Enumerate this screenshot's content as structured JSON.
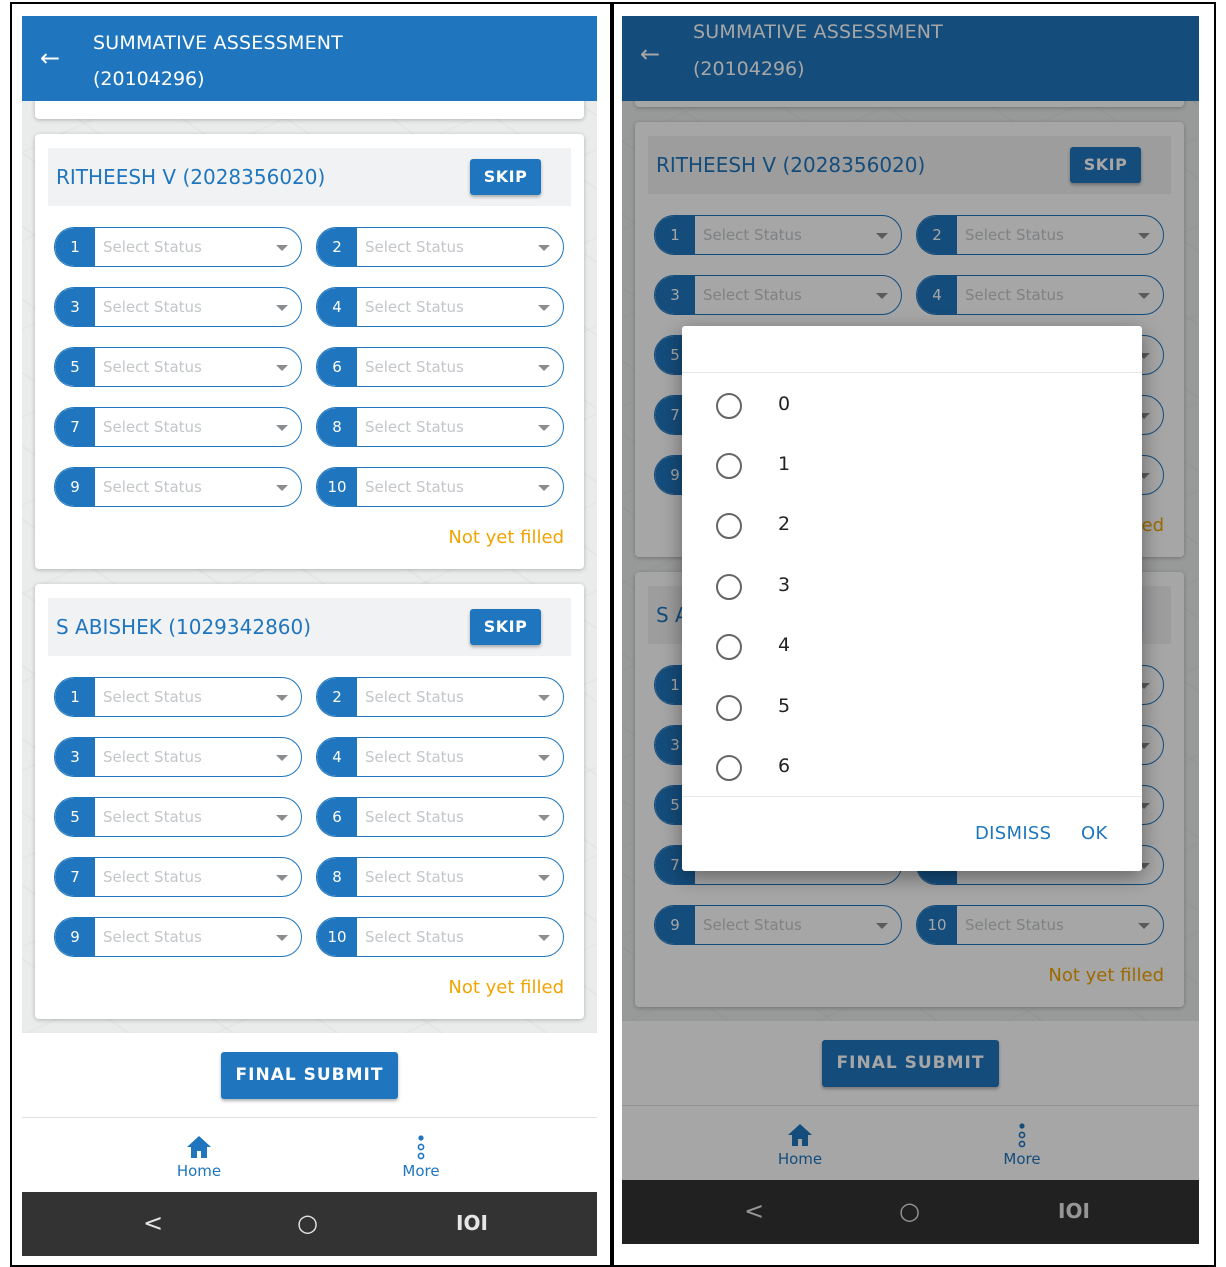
{
  "app": {
    "title_line1": "SUMMATIVE ASSESSMENT",
    "title_line2": "(20104296)",
    "back_icon": "arrow-left-icon"
  },
  "students": [
    {
      "name": "RITHEESH V (2028356020)",
      "skip_label": "SKIP",
      "status": "Not yet filled"
    },
    {
      "name": "S ABISHEK (1029342860)",
      "skip_label": "SKIP",
      "status": "Not yet filled"
    }
  ],
  "question_numbers": [
    "1",
    "2",
    "3",
    "4",
    "5",
    "6",
    "7",
    "8",
    "9",
    "10"
  ],
  "select_placeholder": "Select Status",
  "final_submit_label": "FINAL SUBMIT",
  "bottom_nav": [
    {
      "label": "Home",
      "icon": "home-icon"
    },
    {
      "label": "More",
      "icon": "more-vertical-icon"
    }
  ],
  "system_nav": {
    "back": "<",
    "home": "○",
    "recents": "IOI"
  },
  "dialog": {
    "options": [
      "0",
      "1",
      "2",
      "3",
      "4",
      "5",
      "6"
    ],
    "dismiss_label": "DISMISS",
    "ok_label": "OK"
  },
  "colors": {
    "primary": "#1f76be",
    "warning": "#f0a400",
    "system_bar": "#333333"
  }
}
